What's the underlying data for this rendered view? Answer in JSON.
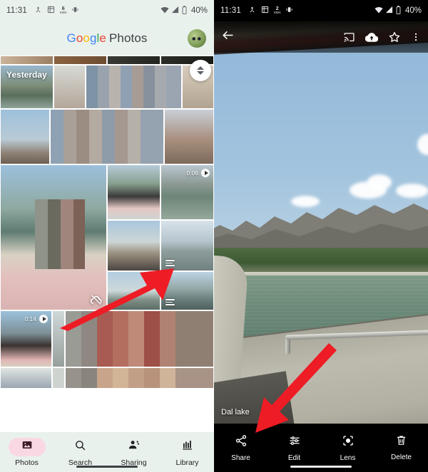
{
  "left_phone": {
    "status_bar": {
      "time": "11:31",
      "icons": [
        "call-merge-icon",
        "screenshot-icon",
        "data-rate-icon",
        "vibrate-icon"
      ],
      "data_rate_value": "6",
      "data_rate_unit": "KB/s",
      "right_icons": [
        "wifi-icon",
        "signal-icon",
        "battery-icon"
      ],
      "battery_percent": "40%"
    },
    "app_bar": {
      "brand_g1": "G",
      "brand_g2": "o",
      "brand_g3": "o",
      "brand_g4": "g",
      "brand_g5": "l",
      "brand_g6": "e",
      "brand_word": "Photos",
      "avatar_label": "account-avatar"
    },
    "grid": {
      "date_label": "Yesterday",
      "video_badges": [
        "0:06",
        "0:14"
      ],
      "scrub_handle": "scroll-handle"
    },
    "bottom_nav": [
      {
        "label": "Photos",
        "icon": "photos-icon",
        "active": true
      },
      {
        "label": "Search",
        "icon": "search-icon",
        "active": false
      },
      {
        "label": "Sharing",
        "icon": "sharing-icon",
        "active": false
      },
      {
        "label": "Library",
        "icon": "library-icon",
        "active": false
      }
    ]
  },
  "right_phone": {
    "status_bar": {
      "time": "11:31",
      "data_rate_value": "2",
      "data_rate_unit": "KB/s",
      "battery_percent": "40%"
    },
    "viewer_top": {
      "back": "back-arrow-icon",
      "actions": [
        "cast-icon",
        "cloud-upload-icon",
        "star-icon",
        "more-vert-icon"
      ]
    },
    "caption": "Dal lake",
    "bottom_actions": [
      {
        "label": "Share",
        "icon": "share-icon"
      },
      {
        "label": "Edit",
        "icon": "edit-icon"
      },
      {
        "label": "Lens",
        "icon": "lens-icon"
      },
      {
        "label": "Delete",
        "icon": "delete-icon"
      }
    ]
  },
  "annotations": {
    "arrow_color": "#ee1c25",
    "arrow_left_target": "photo-stack-thumbnail",
    "arrow_right_target": "photo-caption"
  },
  "colors": {
    "surface": "#e9f1ec",
    "active_pill": "#f9d8e4",
    "accent_red": "#ee1c25",
    "dark_bg": "#000000"
  }
}
